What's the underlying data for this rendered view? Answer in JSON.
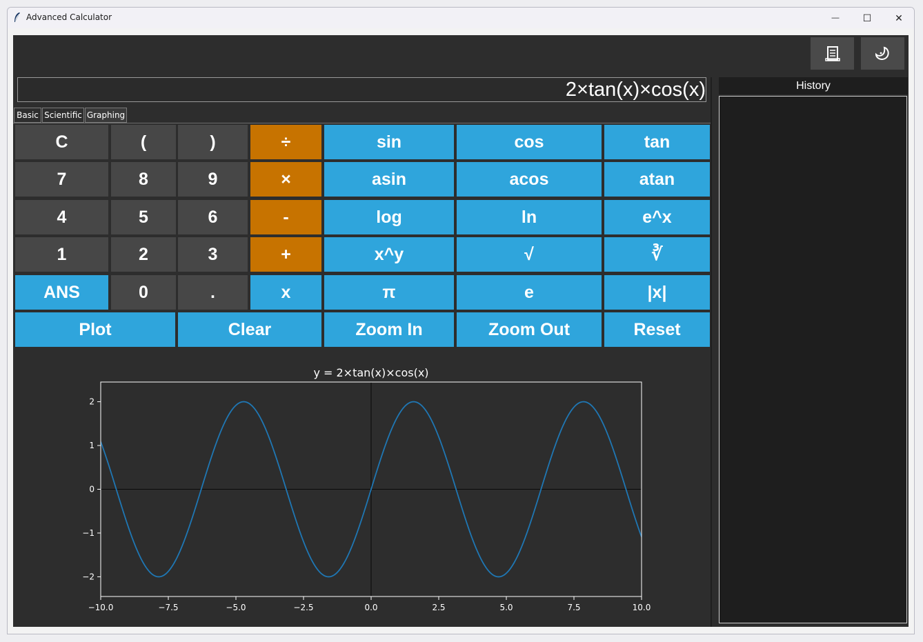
{
  "window": {
    "title": "Advanced Calculator",
    "minimize_glyph": "—",
    "maximize_glyph": "☐",
    "close_glyph": "✕"
  },
  "toolbar": {
    "history_icon": "scroll-icon",
    "theme_icon": "moon-icon"
  },
  "display": {
    "expression": "2×tan(x)×cos(x)"
  },
  "tabs": [
    {
      "label": "Basic"
    },
    {
      "label": "Scientific"
    },
    {
      "label": "Graphing"
    }
  ],
  "keypad": {
    "rows": [
      [
        "C",
        "(",
        ")",
        "÷",
        "sin",
        "cos",
        "tan"
      ],
      [
        "7",
        "8",
        "9",
        "×",
        "asin",
        "acos",
        "atan"
      ],
      [
        "4",
        "5",
        "6",
        "-",
        "log",
        "ln",
        "e^x"
      ],
      [
        "1",
        "2",
        "3",
        "+",
        "x^y",
        "√",
        "∛"
      ],
      [
        "ANS",
        "0",
        ".",
        "x",
        "π",
        "e",
        "|x|"
      ]
    ],
    "graph_row": [
      "Plot",
      "Clear",
      "Zoom In",
      "Zoom Out",
      "Reset"
    ]
  },
  "history": {
    "title": "History"
  },
  "colors": {
    "background": "#2d2d2d",
    "number_button": "#474747",
    "operator_button": "#c77300",
    "function_button": "#2fa5dc",
    "plot_line": "#1f77b4"
  },
  "chart_data": {
    "type": "line",
    "title": "y = 2×tan(x)×cos(x)",
    "function": "2*sin(x)",
    "xlim": [
      -10,
      10
    ],
    "ylim": [
      -2.45,
      2.45
    ],
    "xticks": [
      -10.0,
      -7.5,
      -5.0,
      -2.5,
      0.0,
      2.5,
      5.0,
      7.5,
      10.0
    ],
    "xtick_labels": [
      "−10.0",
      "−7.5",
      "−5.0",
      "−2.5",
      "0.0",
      "2.5",
      "5.0",
      "7.5",
      "10.0"
    ],
    "yticks": [
      -2,
      -1,
      0,
      1,
      2
    ],
    "ytick_labels": [
      "−2",
      "−1",
      "0",
      "1",
      "2"
    ],
    "axes_lines_at_zero": true,
    "grid": false,
    "legend": "none"
  }
}
